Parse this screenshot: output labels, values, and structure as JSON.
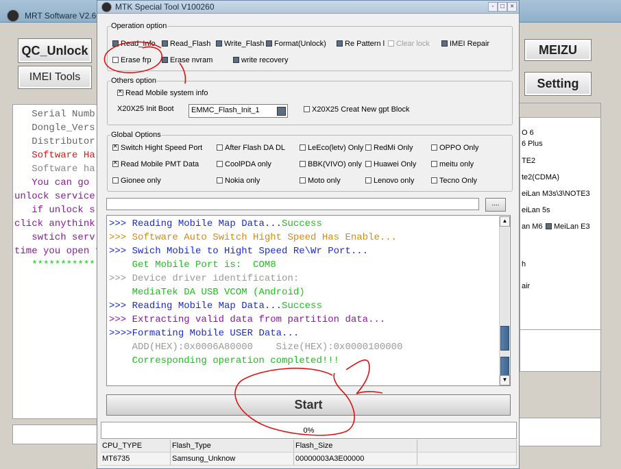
{
  "bg_window": {
    "title": "MRT Software V2.60",
    "buttons": {
      "qc_unlock": "QC_Unlock",
      "imei_tools": "IMEI Tools",
      "meizu": "MEIZU",
      "setting": "Setting"
    },
    "log_lines": [
      {
        "text": "   Serial Numb",
        "color": "#666666"
      },
      {
        "text": "   Dongle_Vers",
        "color": "#666666"
      },
      {
        "text": "   Distributor",
        "color": "#666666"
      },
      {
        "text": "   Software Ha",
        "color": "#d81b1b"
      },
      {
        "text": "   Software ha",
        "color": "#888888"
      },
      {
        "text": "   You can go",
        "color": "#8a1a9a"
      },
      {
        "text": "unlock service",
        "color": "#8a1a9a"
      },
      {
        "text": "   if unlock s",
        "color": "#8a1a9a"
      },
      {
        "text": "click anythink",
        "color": "#8a1a9a"
      },
      {
        "text": "   swtich serv",
        "color": "#8a1a9a"
      },
      {
        "text": "time you open t",
        "color": "#8a1a9a"
      },
      {
        "text": "   ***********",
        "color": "#18c418"
      }
    ],
    "right_items": [
      "O 6",
      "6 Plus",
      "TE2",
      "te2(CDMA)",
      "eiLan M3s\\3\\NOTE3",
      "eiLan 5s",
      "an M6",
      "MeiLan E3",
      "h",
      "air"
    ]
  },
  "dialog": {
    "title": "MTK Special Tool V100260",
    "title_controls": [
      "-",
      "□",
      "×"
    ],
    "operation_option": {
      "legend": "Operation option",
      "items": [
        {
          "label": "Read_Info",
          "disabled": false
        },
        {
          "label": "Read_Flash",
          "disabled": false
        },
        {
          "label": "Write_Flash",
          "disabled": false
        },
        {
          "label": "Format(Unlock)",
          "disabled": false
        },
        {
          "label": "Re Pattern l",
          "disabled": false
        },
        {
          "label": "Clear lock",
          "disabled": true
        },
        {
          "label": "IMEI Repair",
          "disabled": false
        },
        {
          "label": "Erase frp",
          "disabled": false
        },
        {
          "label": "Erase nvram",
          "disabled": false
        },
        {
          "label": "write recovery",
          "disabled": false
        }
      ]
    },
    "others_option": {
      "legend": "Others option",
      "read_mobile_info": "Read Mobile system info",
      "init_boot_label": "X20X25 Init Boot",
      "init_boot_value": "EMMC_Flash_Init_1",
      "creat_gpt": "X20X25 Creat New gpt Block"
    },
    "global_options": {
      "legend": "Global Options",
      "items": [
        {
          "label": "Switch Hight Speed Port",
          "checked": true
        },
        {
          "label": "After Flash DA DL",
          "checked": false
        },
        {
          "label": "LeEco(letv) Only",
          "checked": false
        },
        {
          "label": "RedMi Only",
          "checked": false
        },
        {
          "label": "OPPO Only",
          "checked": false
        },
        {
          "label": "Read Mobile PMT Data",
          "checked": true
        },
        {
          "label": "CoolPDA only",
          "checked": false
        },
        {
          "label": "BBK(VIVO) only",
          "checked": false
        },
        {
          "label": "Huawei Only",
          "checked": false
        },
        {
          "label": "meitu only",
          "checked": false
        },
        {
          "label": "Gionee only",
          "checked": false
        },
        {
          "label": "Nokia only",
          "checked": false
        },
        {
          "label": "Moto only",
          "checked": false
        },
        {
          "label": "Lenovo only",
          "checked": false
        },
        {
          "label": "Tecno Only",
          "checked": false
        }
      ]
    },
    "path_input": {
      "value": "",
      "browse_label": "...."
    },
    "log": [
      {
        "prefix": ">>> ",
        "text": "Reading Mobile Map Data...",
        "color": "#1a2bd6",
        "suffix": "Success",
        "suffix_color": "#18c418"
      },
      {
        "prefix": ">>> ",
        "text": "Software Auto Switch Hight Speed Has Enable...",
        "color": "#d58a10",
        "suffix": "",
        "suffix_color": ""
      },
      {
        "prefix": ">>> ",
        "text": "Swich Mobile to Hight Speed Re\\Wr Port...",
        "color": "#1a2bd6",
        "suffix": "",
        "suffix_color": ""
      },
      {
        "prefix": "    ",
        "text": "Get Mobile Port is:  COM8",
        "color": "#18c418",
        "suffix": "",
        "suffix_color": ""
      },
      {
        "prefix": ">>> ",
        "text": "Device driver identification:",
        "color": "#9a9a9a",
        "suffix": "",
        "suffix_color": ""
      },
      {
        "prefix": "    ",
        "text": "MediaTek DA USB VCOM (Android)",
        "color": "#18c418",
        "suffix": "",
        "suffix_color": ""
      },
      {
        "prefix": ">>> ",
        "text": "Reading Mobile Map Data...",
        "color": "#1a2bd6",
        "suffix": "Success",
        "suffix_color": "#18c418"
      },
      {
        "prefix": ">>> ",
        "text": "Extracting valid data from partition data...",
        "color": "#8a1a9a",
        "suffix": "",
        "suffix_color": ""
      },
      {
        "prefix": ">>>>",
        "text": "Formating Mobile USER Data...",
        "color": "#1a2bd6",
        "suffix": "",
        "suffix_color": ""
      },
      {
        "prefix": "    ",
        "text": "ADD(HEX):0x0006A80000    Size(HEX):0x0000100000",
        "color": "#9a9a9a",
        "suffix": "",
        "suffix_color": ""
      },
      {
        "prefix": "    ",
        "text": "Corresponding operation completed!!!",
        "color": "#18c418",
        "suffix": "",
        "suffix_color": ""
      }
    ],
    "start_label": "Start",
    "progress_text": "0%",
    "progress_value": 0,
    "table": {
      "headers": [
        "CPU_TYPE",
        "Flash_Type",
        "Flash_Size",
        ""
      ],
      "row": [
        "MT6735",
        "Samsung_Unknow",
        "00000003A3E00000",
        ""
      ]
    }
  }
}
